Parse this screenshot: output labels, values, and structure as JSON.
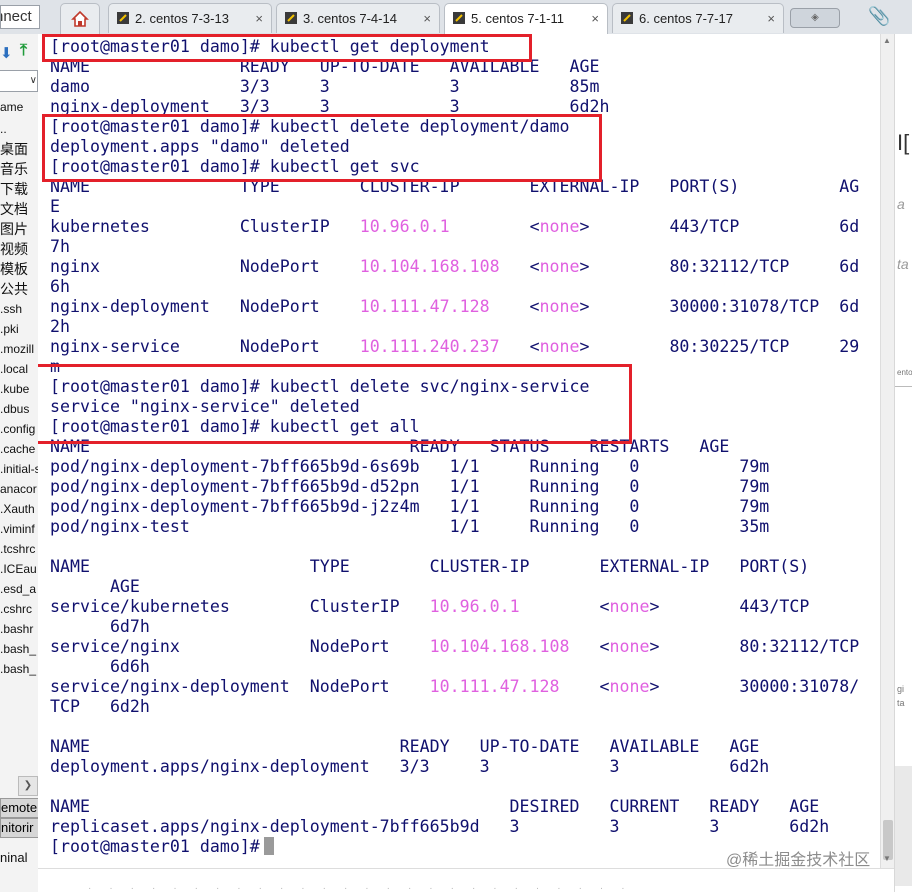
{
  "tabbar": {
    "left_field": "nnect",
    "tabs": [
      {
        "label": "2. centos 7-3-13",
        "active": false
      },
      {
        "label": "3. centos 7-4-14",
        "active": false
      },
      {
        "label": "5. centos 7-1-11",
        "active": true
      },
      {
        "label": "6. centos 7-7-17",
        "active": false
      }
    ],
    "close_glyph": "×"
  },
  "sidepanel": {
    "name_header": "ame",
    "items": [
      "..",
      "桌面",
      "音乐",
      "下载",
      "文档",
      "图片",
      "视频",
      "模板",
      "公共",
      ".ssh",
      ".pki",
      ".mozill",
      ".local",
      ".kube",
      ".dbus",
      ".config",
      ".cache",
      ".initial-s",
      "anacor",
      ".Xauth",
      ".viminf",
      ".tcshrc",
      ".ICEau",
      ".esd_a",
      ".cshrc",
      ".bashr",
      ".bash_",
      ".bash_"
    ],
    "remote1": "emote",
    "remote2": "nitorir",
    "terminal_label": "ninal"
  },
  "rightstrip": {
    "texts": [
      "I[",
      "a",
      "ta",
      "ento",
      "gi",
      "ta"
    ]
  },
  "terminal": {
    "prompt": "[root@master01 damo]# ",
    "lines": [
      [
        {
          "t": "[root@master01 damo]# kubectl get deployment"
        }
      ],
      [
        {
          "t": "NAME               READY   UP-TO-DATE   AVAILABLE   AGE"
        }
      ],
      [
        {
          "t": "damo               3/3     3            3           85m"
        }
      ],
      [
        {
          "t": "nginx-deployment   3/3     3            3           6d2h"
        }
      ],
      [
        {
          "t": "[root@master01 damo]# kubectl delete deployment/damo"
        }
      ],
      [
        {
          "t": "deployment.apps \"damo\" deleted"
        }
      ],
      [
        {
          "t": "[root@master01 damo]# kubectl get svc"
        }
      ],
      [
        {
          "t": "NAME               TYPE        CLUSTER-IP       EXTERNAL-IP   PORT(S)          AG"
        }
      ],
      [
        {
          "t": "E"
        }
      ],
      [
        {
          "t": "kubernetes         ClusterIP   "
        },
        {
          "t": "10.96.0.1",
          "c": "ip"
        },
        {
          "t": "        "
        },
        {
          "t": "<"
        },
        {
          "t": "none",
          "c": "none"
        },
        {
          "t": ">        443/TCP          6d"
        }
      ],
      [
        {
          "t": "7h"
        }
      ],
      [
        {
          "t": "nginx              NodePort    "
        },
        {
          "t": "10.104.168.108",
          "c": "ip"
        },
        {
          "t": "   "
        },
        {
          "t": "<"
        },
        {
          "t": "none",
          "c": "none"
        },
        {
          "t": ">        80:32112/TCP     6d"
        }
      ],
      [
        {
          "t": "6h"
        }
      ],
      [
        {
          "t": "nginx-deployment   NodePort    "
        },
        {
          "t": "10.111.47.128",
          "c": "ip"
        },
        {
          "t": "    "
        },
        {
          "t": "<"
        },
        {
          "t": "none",
          "c": "none"
        },
        {
          "t": ">        30000:31078/TCP  6d"
        }
      ],
      [
        {
          "t": "2h"
        }
      ],
      [
        {
          "t": "nginx-service      NodePort    "
        },
        {
          "t": "10.111.240.237",
          "c": "ip"
        },
        {
          "t": "   "
        },
        {
          "t": "<"
        },
        {
          "t": "none",
          "c": "none"
        },
        {
          "t": ">        80:30225/TCP     29"
        }
      ],
      [
        {
          "t": "m"
        }
      ],
      [
        {
          "t": "[root@master01 damo]# kubectl delete svc/nginx-service"
        }
      ],
      [
        {
          "t": "service \"nginx-service\" deleted"
        }
      ],
      [
        {
          "t": "[root@master01 damo]# kubectl get all"
        }
      ],
      [
        {
          "t": "NAME                                READY   STATUS    RESTARTS   AGE"
        }
      ],
      [
        {
          "t": "pod/nginx-deployment-7bff665b9d-6s69b   1/1     Running   0          79m"
        }
      ],
      [
        {
          "t": "pod/nginx-deployment-7bff665b9d-d52pn   1/1     Running   0          79m"
        }
      ],
      [
        {
          "t": "pod/nginx-deployment-7bff665b9d-j2z4m   1/1     Running   0          79m"
        }
      ],
      [
        {
          "t": "pod/nginx-test                          1/1     Running   0          35m"
        }
      ],
      [
        {
          "t": ""
        }
      ],
      [
        {
          "t": "NAME                      TYPE        CLUSTER-IP       EXTERNAL-IP   PORT(S)"
        }
      ],
      [
        {
          "t": "      AGE"
        }
      ],
      [
        {
          "t": "service/kubernetes        ClusterIP   "
        },
        {
          "t": "10.96.0.1",
          "c": "ip"
        },
        {
          "t": "        "
        },
        {
          "t": "<"
        },
        {
          "t": "none",
          "c": "none"
        },
        {
          "t": ">        443/TCP"
        }
      ],
      [
        {
          "t": "      6d7h"
        }
      ],
      [
        {
          "t": "service/nginx             NodePort    "
        },
        {
          "t": "10.104.168.108",
          "c": "ip"
        },
        {
          "t": "   "
        },
        {
          "t": "<"
        },
        {
          "t": "none",
          "c": "none"
        },
        {
          "t": ">        80:32112/TCP"
        }
      ],
      [
        {
          "t": "      6d6h"
        }
      ],
      [
        {
          "t": "service/nginx-deployment  NodePort    "
        },
        {
          "t": "10.111.47.128",
          "c": "ip"
        },
        {
          "t": "    "
        },
        {
          "t": "<"
        },
        {
          "t": "none",
          "c": "none"
        },
        {
          "t": ">        30000:31078/"
        }
      ],
      [
        {
          "t": "TCP   6d2h"
        }
      ],
      [
        {
          "t": ""
        }
      ],
      [
        {
          "t": "NAME                               READY   UP-TO-DATE   AVAILABLE   AGE"
        }
      ],
      [
        {
          "t": "deployment.apps/nginx-deployment   3/3     3            3           6d2h"
        }
      ],
      [
        {
          "t": ""
        }
      ],
      [
        {
          "t": "NAME                                          DESIRED   CURRENT   READY   AGE"
        }
      ],
      [
        {
          "t": "replicaset.apps/nginx-deployment-7bff665b9d   3         3         3       6d2h"
        }
      ],
      [
        {
          "t": "[root@master01 damo]#"
        },
        {
          "cursor": true
        }
      ]
    ]
  },
  "watermark": "@稀土掘金技术社区",
  "colors": {
    "terminal_text": "#10106e",
    "ip_highlight": "#e060e0",
    "annotation_box": "#e3202a"
  }
}
